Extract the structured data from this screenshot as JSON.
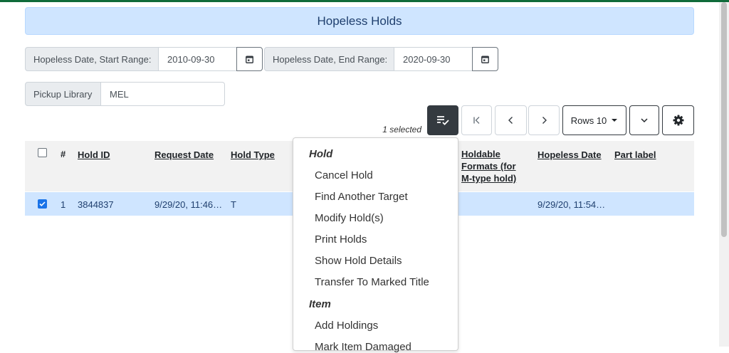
{
  "page": {
    "title": "Hopeless Holds"
  },
  "filters": {
    "start_label": "Hopeless Date, Start Range:",
    "start_value": "2010-09-30",
    "end_label": "Hopeless Date, End Range:",
    "end_value": "2020-09-30",
    "pickup_label": "Pickup Library",
    "pickup_value": "MEL"
  },
  "toolbar": {
    "selected_text": "1 selected",
    "rows_label": "Rows 10"
  },
  "grid": {
    "columns": {
      "num": "#",
      "hold_id": "Hold ID",
      "request_date": "Request Date",
      "hold_type": "Hold Type",
      "holdable_1": "Holdable",
      "holdable_2": "Formats (for",
      "holdable_3": "M-type hold)",
      "hopeless_date": "Hopeless Date",
      "part_label": "Part label"
    },
    "rows": [
      {
        "num": "1",
        "hold_id": "3844837",
        "request_date": "9/29/20, 11:46…",
        "hold_type": "T",
        "holdable_formats": "",
        "hopeless_date": "9/29/20, 11:54…",
        "part_label": "",
        "selected": true
      }
    ]
  },
  "actions_menu": {
    "hold_header": "Hold",
    "hold_items": [
      "Cancel Hold",
      "Find Another Target",
      "Modify Hold(s)",
      "Print Holds",
      "Show Hold Details",
      "Transfer To Marked Title"
    ],
    "item_header": "Item",
    "item_items": [
      "Add Holdings",
      "Mark Item Damaged"
    ]
  },
  "colors": {
    "accent": "#0f6b3a",
    "header_bg": "#cfe5ff",
    "selected_row": "#cfe5ff",
    "dark_button": "#343a40"
  },
  "icons": {
    "calendar": "calendar-icon",
    "actions": "list-check-icon",
    "first": "first-page-icon",
    "prev": "chevron-left-icon",
    "next": "chevron-right-icon",
    "expand": "chevron-down-icon",
    "settings": "gear-icon"
  }
}
